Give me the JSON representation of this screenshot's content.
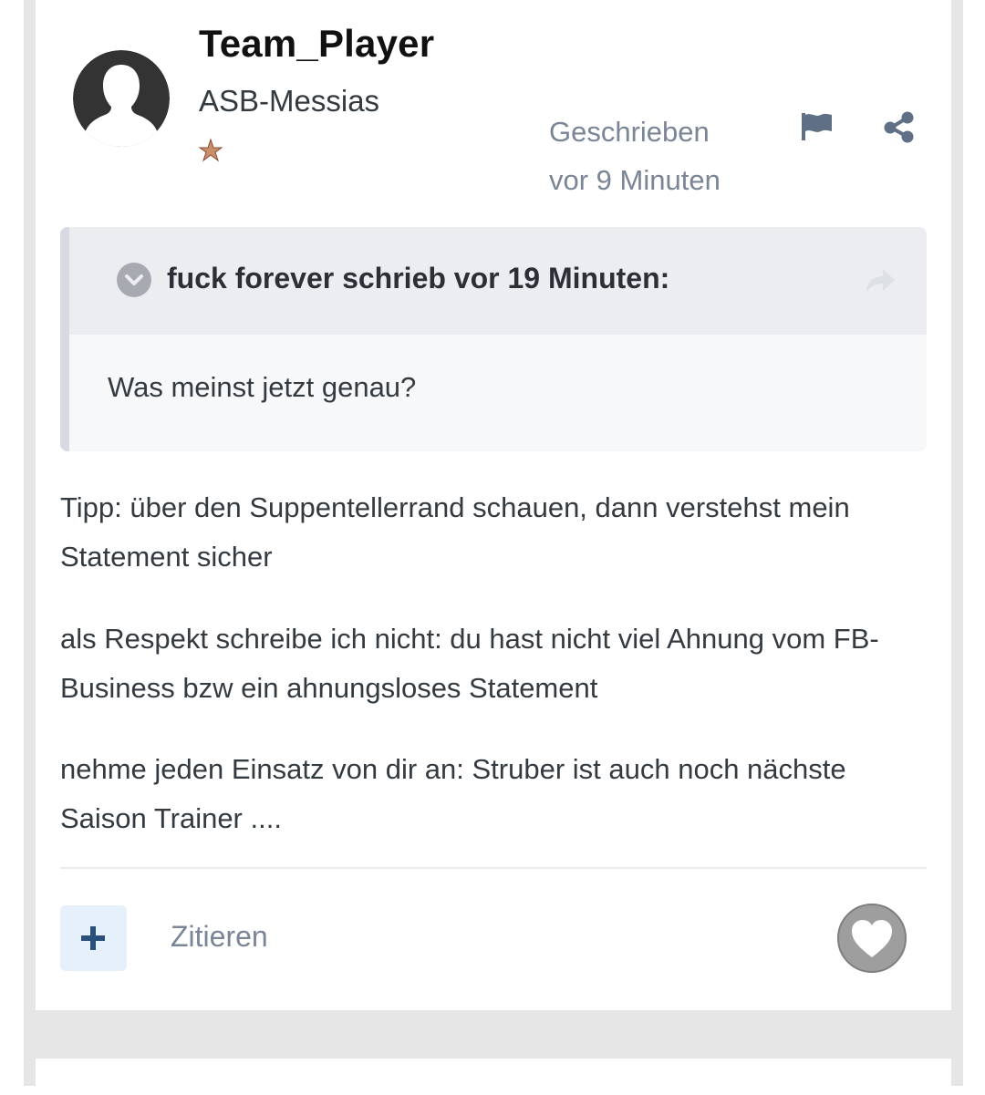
{
  "post": {
    "author": {
      "name": "Team_Player",
      "rank": "ASB-Messias",
      "avatar_icon": "default-avatar-icon",
      "rank_icon": "star-icon"
    },
    "date_line1": "Geschrieben",
    "date_line2": "vor 9 Minuten",
    "icons": {
      "report": "flag-icon",
      "share": "share-icon"
    },
    "quote": {
      "citation": "fuck forever schrieb vor 19 Minuten:",
      "body": "Was meinst jetzt genau?",
      "toggle_icon": "chevron-down-icon",
      "goto_icon": "share-arrow-icon"
    },
    "paragraphs": [
      "Tipp: über den Suppentellerrand schauen, dann verstehst mein Statement sicher",
      "als Respekt schreibe ich nicht: du hast nicht viel Ahnung vom FB-Business bzw ein ahnungsloses Statement",
      "nehme jeden Einsatz von dir an: Struber ist auch noch nächste Saison Trainer ...."
    ],
    "footer": {
      "reputation_icon": "plus-icon",
      "quote_label": "Zitieren",
      "like_icon": "heart-icon"
    }
  },
  "colors": {
    "accent": "#2b4f7b",
    "meta_text": "#7a8596",
    "body_text": "#333a40",
    "quote_header_bg": "#ebedf1"
  }
}
